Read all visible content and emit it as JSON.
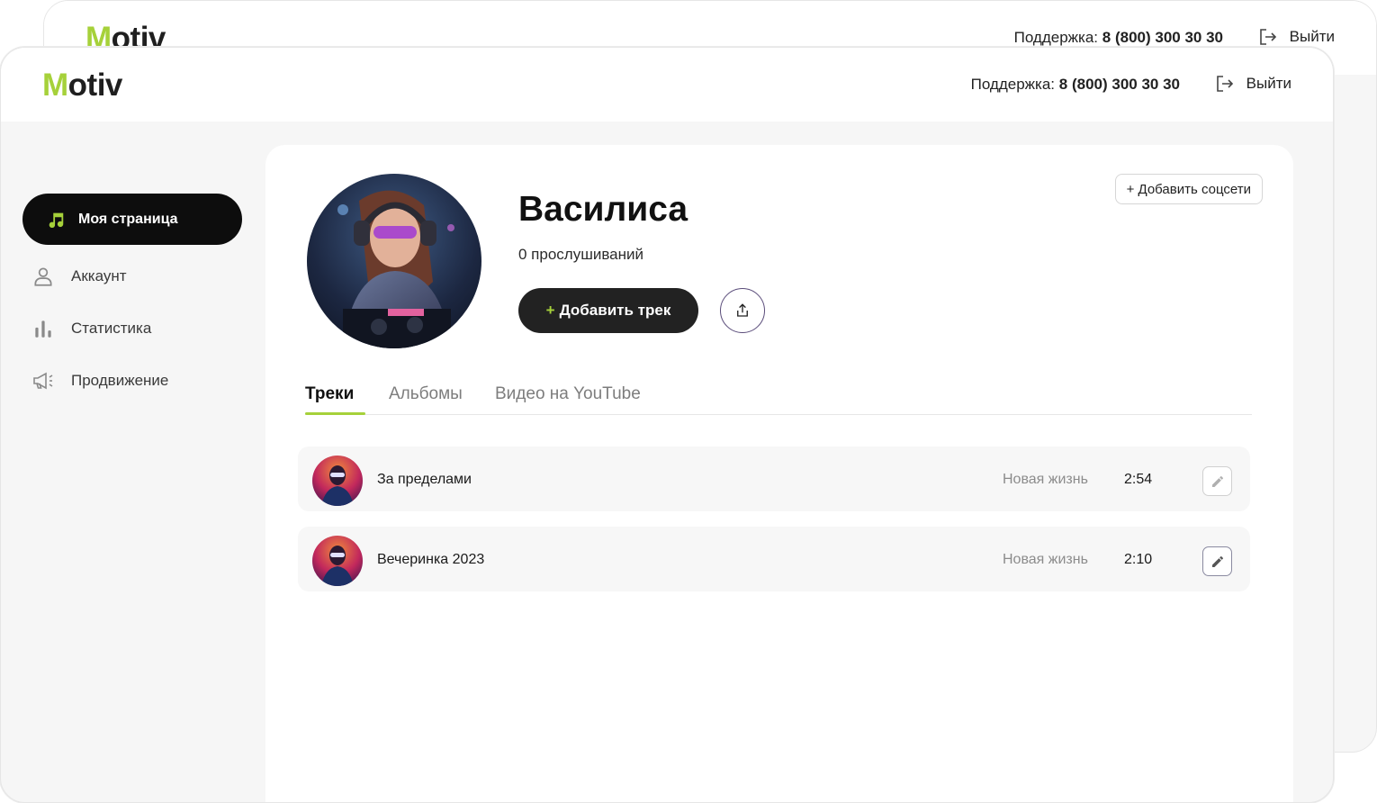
{
  "brand": {
    "logo_first": "M",
    "logo_rest": "otiv",
    "accent": "#a6d13a"
  },
  "header": {
    "support_label": "Поддержка:",
    "support_phone": "8 (800) 300 30 30",
    "logout_label": "Выйти"
  },
  "sidebar": {
    "items": [
      {
        "label": "Моя страница",
        "icon": "music-note-icon",
        "active": true
      },
      {
        "label": "Аккаунт",
        "icon": "user-icon"
      },
      {
        "label": "Статистика",
        "icon": "bar-chart-icon"
      },
      {
        "label": "Продвижение",
        "icon": "megaphone-icon"
      }
    ]
  },
  "profile": {
    "name": "Василиса",
    "plays": "0 прослушиваний",
    "add_track_plus": "+",
    "add_track_label": "Добавить трек",
    "add_social_label": "+ Добавить соцсети"
  },
  "tabs": [
    {
      "label": "Треки",
      "active": true
    },
    {
      "label": "Альбомы"
    },
    {
      "label": "Видео на YouTube"
    }
  ],
  "tracks": [
    {
      "title": "За пределами",
      "album": "Новая жизнь",
      "duration": "2:54"
    },
    {
      "title": "Вечеринка 2023",
      "album": "Новая жизнь",
      "duration": "2:10"
    }
  ]
}
